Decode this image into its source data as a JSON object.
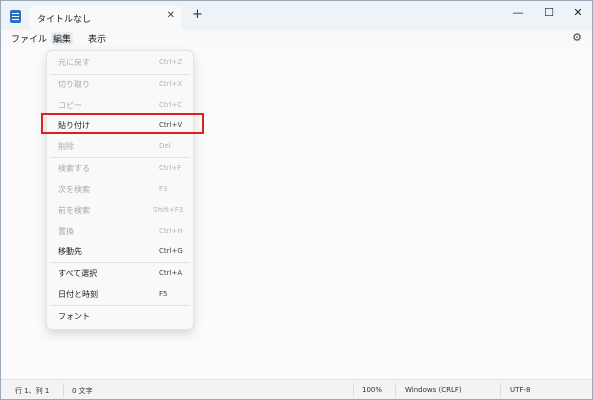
{
  "tab": {
    "title": "タイトルなし",
    "close": "✕",
    "new": "+"
  },
  "window_controls": {
    "minimize": "—",
    "maximize": "☐",
    "close": "✕"
  },
  "menubar": {
    "items": [
      "ファイル",
      "編集",
      "表示"
    ],
    "settings_icon": "gear-icon"
  },
  "edit_menu": [
    {
      "label": "元に戻す",
      "shortcut": "Ctrl+Z",
      "enabled": false
    },
    {
      "label": "切り取り",
      "shortcut": "Ctrl+X",
      "enabled": false
    },
    {
      "label": "コピー",
      "shortcut": "Ctrl+C",
      "enabled": false
    },
    {
      "label": "貼り付け",
      "shortcut": "Ctrl+V",
      "enabled": true
    },
    {
      "label": "削除",
      "shortcut": "Del",
      "enabled": false
    },
    {
      "label": "検索する",
      "shortcut": "Ctrl+F",
      "enabled": false
    },
    {
      "label": "次を検索",
      "shortcut": "F3",
      "enabled": false
    },
    {
      "label": "前を検索",
      "shortcut": "Shift+F3",
      "enabled": false
    },
    {
      "label": "置換",
      "shortcut": "Ctrl+H",
      "enabled": false
    },
    {
      "label": "移動先",
      "shortcut": "Ctrl+G",
      "enabled": true
    },
    {
      "label": "すべて選択",
      "shortcut": "Ctrl+A",
      "enabled": true
    },
    {
      "label": "日付と時刻",
      "shortcut": "F5",
      "enabled": true
    },
    {
      "label": "フォント",
      "shortcut": "",
      "enabled": true
    }
  ],
  "highlight_color": "#e0201e",
  "status": {
    "position": "行 1、列 1",
    "chars": "0 文字",
    "zoom": "100%",
    "line_ending": "Windows (CRLF)",
    "encoding": "UTF-8"
  }
}
